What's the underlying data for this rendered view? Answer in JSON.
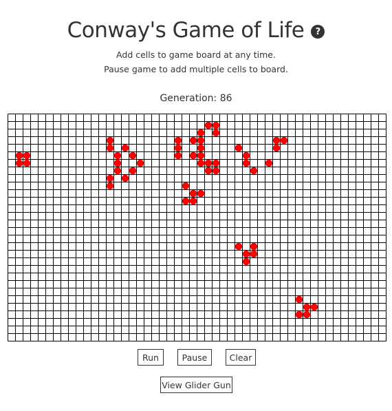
{
  "header": {
    "title": "Conway's Game of Life",
    "help_icon": "?",
    "subtitle_line1": "Add cells to game board at any time.",
    "subtitle_line2": "Pause game to add multiple cells to board."
  },
  "status": {
    "generation_text": "Generation: 86",
    "generation": 86
  },
  "board": {
    "columns": 50,
    "rows": 30,
    "line_color": "#000000",
    "cell_color": "#ff0000",
    "live_cells": [
      [
        1,
        5
      ],
      [
        2,
        5
      ],
      [
        1,
        6
      ],
      [
        2,
        6
      ],
      [
        13,
        3
      ],
      [
        13,
        4
      ],
      [
        15,
        4
      ],
      [
        14,
        5
      ],
      [
        16,
        5
      ],
      [
        14,
        6
      ],
      [
        17,
        6
      ],
      [
        14,
        7
      ],
      [
        16,
        7
      ],
      [
        13,
        8
      ],
      [
        15,
        8
      ],
      [
        13,
        9
      ],
      [
        26,
        1
      ],
      [
        27,
        1
      ],
      [
        25,
        2
      ],
      [
        27,
        2
      ],
      [
        22,
        3
      ],
      [
        24,
        3
      ],
      [
        25,
        3
      ],
      [
        22,
        4
      ],
      [
        25,
        4
      ],
      [
        22,
        5
      ],
      [
        24,
        5
      ],
      [
        25,
        5
      ],
      [
        25,
        6
      ],
      [
        26,
        6
      ],
      [
        27,
        6
      ],
      [
        26,
        7
      ],
      [
        27,
        7
      ],
      [
        23,
        9
      ],
      [
        24,
        10
      ],
      [
        25,
        10
      ],
      [
        23,
        11
      ],
      [
        24,
        11
      ],
      [
        35,
        3
      ],
      [
        36,
        3
      ],
      [
        30,
        4
      ],
      [
        31,
        5
      ],
      [
        35,
        4
      ],
      [
        31,
        6
      ],
      [
        34,
        6
      ],
      [
        32,
        7
      ],
      [
        30,
        17
      ],
      [
        32,
        17
      ],
      [
        31,
        18
      ],
      [
        32,
        18
      ],
      [
        31,
        19
      ],
      [
        38,
        24
      ],
      [
        39,
        25
      ],
      [
        40,
        25
      ],
      [
        38,
        26
      ],
      [
        39,
        26
      ]
    ]
  },
  "controls": {
    "run": "Run",
    "pause": "Pause",
    "clear": "Clear",
    "glider_gun": "View Glider Gun"
  }
}
